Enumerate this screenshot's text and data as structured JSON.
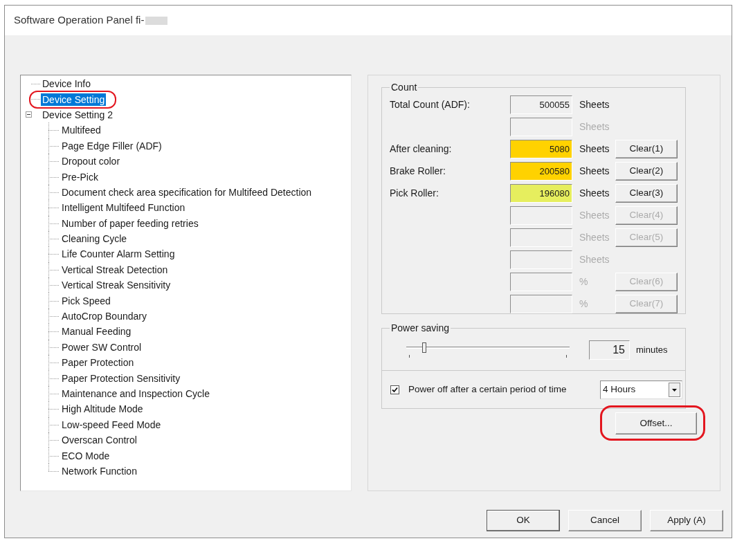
{
  "window": {
    "title": "Software Operation Panel fi-"
  },
  "tree": [
    {
      "label": "Device Info",
      "selected": false
    },
    {
      "label": "Device Setting",
      "selected": true,
      "highlighted": true
    },
    {
      "label": "Device Setting 2",
      "selected": false,
      "expanded": true,
      "children": [
        {
          "label": "Multifeed",
          "selected": false
        },
        {
          "label": "Page Edge Filler (ADF)",
          "selected": false
        },
        {
          "label": "Dropout color",
          "selected": false
        },
        {
          "label": "Pre-Pick",
          "selected": false
        },
        {
          "label": "Document check area specification for Multifeed Detection",
          "selected": false
        },
        {
          "label": "Intelligent Multifeed Function",
          "selected": false
        },
        {
          "label": "Number of paper feeding retries",
          "selected": false
        },
        {
          "label": "Cleaning Cycle",
          "selected": false
        },
        {
          "label": "Life Counter Alarm Setting",
          "selected": false
        },
        {
          "label": "Vertical Streak Detection",
          "selected": false
        },
        {
          "label": "Vertical Streak Sensitivity",
          "selected": false
        },
        {
          "label": "Pick Speed",
          "selected": false
        },
        {
          "label": "AutoCrop Boundary",
          "selected": false
        },
        {
          "label": "Manual Feeding",
          "selected": false
        },
        {
          "label": "Power SW Control",
          "selected": false
        },
        {
          "label": "Paper Protection",
          "selected": false
        },
        {
          "label": "Paper Protection Sensitivity",
          "selected": false
        },
        {
          "label": "Maintenance and Inspection Cycle",
          "selected": false
        },
        {
          "label": "High Altitude Mode",
          "selected": false
        },
        {
          "label": "Low-speed Feed Mode",
          "selected": false
        },
        {
          "label": "Overscan Control",
          "selected": false
        },
        {
          "label": "ECO Mode",
          "selected": false
        },
        {
          "label": "Network Function",
          "selected": false
        }
      ]
    }
  ],
  "count": {
    "title": "Count",
    "rows": [
      {
        "label": "Total Count (ADF):",
        "value": "500055",
        "unit": "Sheets",
        "disabled": false
      },
      {
        "unit": "Sheets",
        "disabled": true
      },
      {
        "label": "After cleaning:",
        "value": "5080",
        "color": "#ffd200",
        "unit": "Sheets",
        "disabled": false,
        "button": "Clear(1)"
      },
      {
        "label": "Brake Roller:",
        "value": "200580",
        "color": "#ffd200",
        "unit": "Sheets",
        "disabled": false,
        "button": "Clear(2)"
      },
      {
        "label": "Pick Roller:",
        "value": "196080",
        "color": "#e6ee5e",
        "unit": "Sheets",
        "disabled": false,
        "button": "Clear(3)"
      },
      {
        "unit": "Sheets",
        "disabled": true,
        "button": "Clear(4)"
      },
      {
        "unit": "Sheets",
        "disabled": true,
        "button": "Clear(5)"
      },
      {
        "unit": "Sheets",
        "disabled": true
      },
      {
        "unit": "%",
        "disabled": true,
        "button": "Clear(6)"
      },
      {
        "unit": "%",
        "disabled": true,
        "button": "Clear(7)"
      }
    ]
  },
  "power_saving": {
    "title": "Power saving",
    "level": 0.1,
    "minutes": "15",
    "unit": "minutes",
    "checkbox": {
      "label": "Power off after a certain period of time",
      "checked": true
    },
    "dropdown": {
      "value": "4 Hours"
    }
  },
  "offset_button": {
    "label": "Offset...",
    "highlighted": true
  },
  "buttons": [
    {
      "label": "OK",
      "default": true
    },
    {
      "label": "Cancel",
      "default": false
    },
    {
      "label": "Apply (A)",
      "default": false
    }
  ]
}
